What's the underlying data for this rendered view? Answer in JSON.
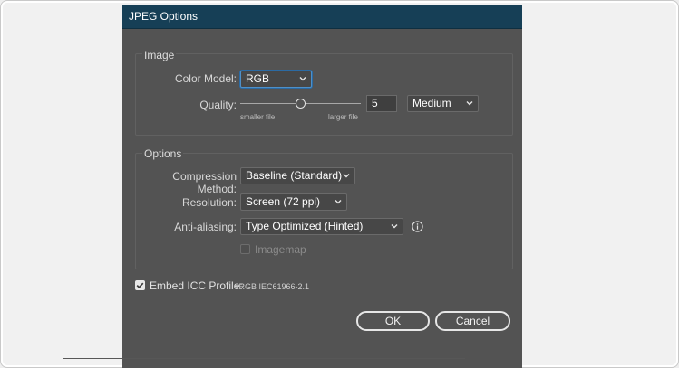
{
  "dialog": {
    "title": "JPEG Options"
  },
  "image_section": {
    "label": "Image",
    "color_model": {
      "label": "Color Model:",
      "value": "RGB"
    },
    "quality": {
      "label": "Quality:",
      "value": "5",
      "preset": "Medium",
      "min_label": "smaller file",
      "max_label": "larger file",
      "slider_fraction": 0.5
    }
  },
  "options_section": {
    "label": "Options",
    "compression": {
      "label": "Compression Method:",
      "value": "Baseline (Standard)"
    },
    "resolution": {
      "label": "Resolution:",
      "value": "Screen (72 ppi)"
    },
    "anti_aliasing": {
      "label": "Anti-aliasing:",
      "value": "Type Optimized (Hinted)"
    },
    "imagemap": {
      "label": "Imagemap",
      "checked": false,
      "disabled": true
    }
  },
  "icc_profile": {
    "label": "Embed ICC Profile:",
    "value": "sRGB IEC61966-2.1",
    "checked": true
  },
  "buttons": {
    "ok": "OK",
    "cancel": "Cancel"
  },
  "colors": {
    "dialog_bg": "#535353",
    "titlebar_bg": "#163f56",
    "focus_ring": "#4e90c9"
  }
}
